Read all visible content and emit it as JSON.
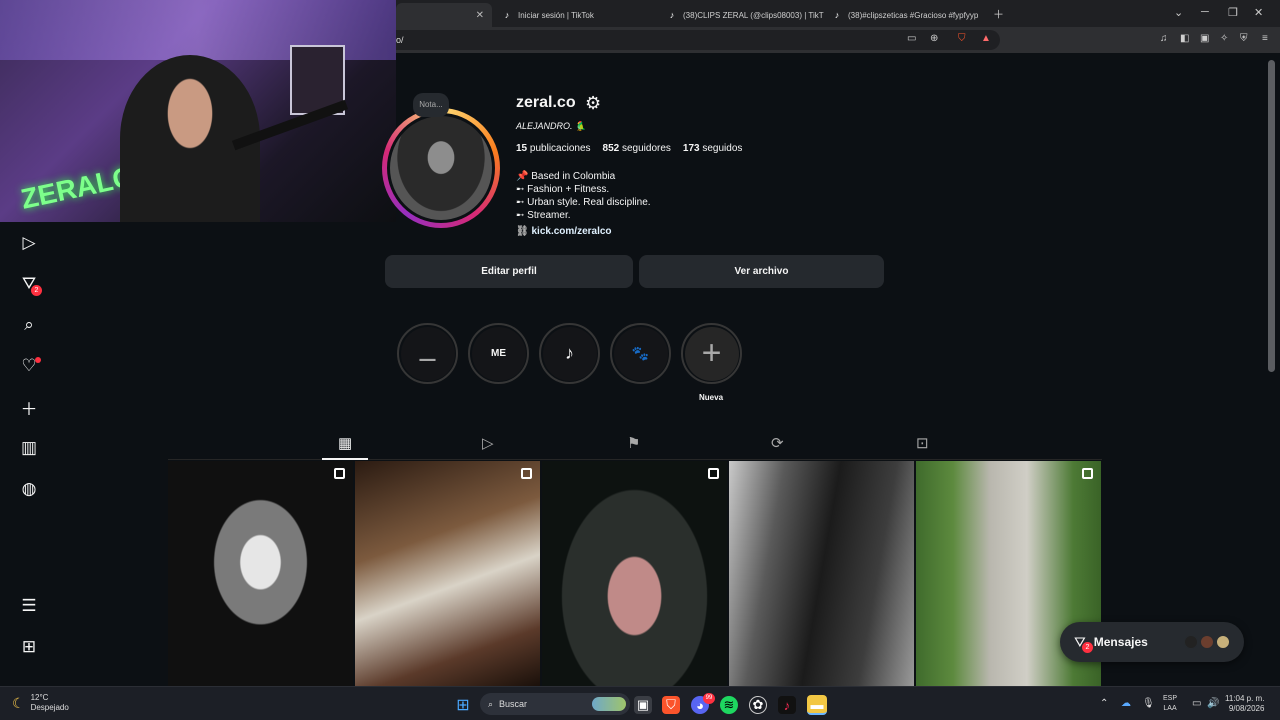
{
  "browser": {
    "tabs": [
      {
        "title": "",
        "active": true
      },
      {
        "title": "Iniciar sesión | TikTok",
        "active": false
      },
      {
        "title": "(38)CLIPS ZERAL (@clips08003) | TikT",
        "active": false
      },
      {
        "title": "(38)#clipszeticas #Gracioso #fypfyyp",
        "active": false
      }
    ],
    "url": "o/"
  },
  "profile": {
    "note": "Nota...",
    "username": "zeral.co",
    "full_name": "ALEJANDRO. 🦜",
    "posts_count": "15",
    "posts_label": "publicaciones",
    "followers_count": "852",
    "followers_label": "seguidores",
    "following_count": "173",
    "following_label": "seguidos",
    "bio": [
      "📌  Based in Colombia",
      "➸ Fashion + Fitness.",
      "➸ Urban style. Real discipline.",
      "➸ Streamer."
    ],
    "link": "kick.com/zeralco",
    "edit_button": "Editar perfil",
    "archive_button": "Ver archivo"
  },
  "highlights": [
    {
      "icon": "dumbbell-icon",
      "glyph": "⚊",
      "label": ""
    },
    {
      "icon": "me-text-icon",
      "glyph": "ME",
      "label": ""
    },
    {
      "icon": "music-note-icon",
      "glyph": "♪",
      "label": ""
    },
    {
      "icon": "paw-icon",
      "glyph": "🐾",
      "label": ""
    },
    {
      "icon": "plus-icon",
      "glyph": "+",
      "label": "Nueva"
    }
  ],
  "rail": {
    "reels_badge": "",
    "messages_badge": "2"
  },
  "messages": {
    "label": "Mensajes",
    "badge": "2"
  },
  "taskbar": {
    "temperature": "12°C",
    "weather": "Despejado",
    "search": "Buscar",
    "lang_top": "ESP",
    "lang_bottom": "LAA",
    "time": "11:04 p. m.",
    "date": "9/08/2026",
    "discord_badge": "99"
  },
  "colors": {
    "background": "#0c1014",
    "button": "#25292e",
    "badge": "#ff3040",
    "link": "#e0f1ff"
  }
}
